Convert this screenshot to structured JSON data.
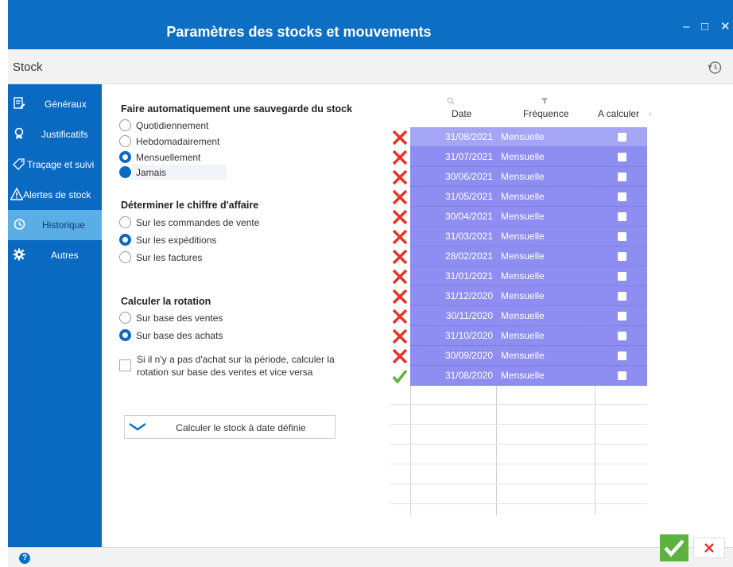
{
  "window": {
    "title": "Paramètres des stocks et mouvements"
  },
  "subbar": {
    "label": "Stock"
  },
  "sidebar": {
    "items": [
      {
        "label": "Généraux",
        "icon": "document-edit-icon"
      },
      {
        "label": "Justificatifs",
        "icon": "award-icon"
      },
      {
        "label": "Traçage et suivi",
        "icon": "tag-icon"
      },
      {
        "label": "Alertes de stock",
        "icon": "warning-icon"
      },
      {
        "label": "Historique",
        "icon": "history-icon",
        "active": true
      },
      {
        "label": "Autres",
        "icon": "gear-icon"
      }
    ]
  },
  "backup": {
    "title": "Faire automatiquement une sauvegarde du stock",
    "options": [
      "Quotidiennement",
      "Hebdomadairement",
      "Mensuellement",
      "Jamais"
    ],
    "selected": "Jamais"
  },
  "turnover": {
    "title": "Déterminer le chiffre d'affaire",
    "options": [
      "Sur les commandes de vente",
      "Sur les expéditions",
      "Sur les factures"
    ],
    "selected": "Sur les expéditions"
  },
  "rotation": {
    "title": "Calculer la rotation",
    "options": [
      "Sur base des ventes",
      "Sur base des achats"
    ],
    "selected": "Sur base des achats",
    "fallback_line1": "Si il n'y a pas d'achat sur la période, calculer la",
    "fallback_line2": "rotation sur base des ventes et vice versa",
    "fallback_checked": false
  },
  "calc_button": {
    "label": "Calculer le stock à date définie"
  },
  "grid": {
    "columns": [
      "Date",
      "Fréquence",
      "A calculer"
    ],
    "rows": [
      {
        "status": "error",
        "date": "31/08/2021",
        "frequency": "Mensuelle",
        "to_calc": false
      },
      {
        "status": "error",
        "date": "31/07/2021",
        "frequency": "Mensuelle",
        "to_calc": false
      },
      {
        "status": "error",
        "date": "30/06/2021",
        "frequency": "Mensuelle",
        "to_calc": false
      },
      {
        "status": "error",
        "date": "31/05/2021",
        "frequency": "Mensuelle",
        "to_calc": false
      },
      {
        "status": "error",
        "date": "30/04/2021",
        "frequency": "Mensuelle",
        "to_calc": false
      },
      {
        "status": "error",
        "date": "31/03/2021",
        "frequency": "Mensuelle",
        "to_calc": false
      },
      {
        "status": "error",
        "date": "28/02/2021",
        "frequency": "Mensuelle",
        "to_calc": false
      },
      {
        "status": "error",
        "date": "31/01/2021",
        "frequency": "Mensuelle",
        "to_calc": false
      },
      {
        "status": "error",
        "date": "31/12/2020",
        "frequency": "Mensuelle",
        "to_calc": false
      },
      {
        "status": "error",
        "date": "30/11/2020",
        "frequency": "Mensuelle",
        "to_calc": false
      },
      {
        "status": "error",
        "date": "31/10/2020",
        "frequency": "Mensuelle",
        "to_calc": false
      },
      {
        "status": "error",
        "date": "30/09/2020",
        "frequency": "Mensuelle",
        "to_calc": false
      },
      {
        "status": "ok",
        "date": "31/08/2020",
        "frequency": "Mensuelle",
        "to_calc": false
      }
    ]
  },
  "colors": {
    "brand": "#0d6fc4",
    "row": "#8e8ef2",
    "error": "#e8332a",
    "ok": "#5db33f"
  }
}
